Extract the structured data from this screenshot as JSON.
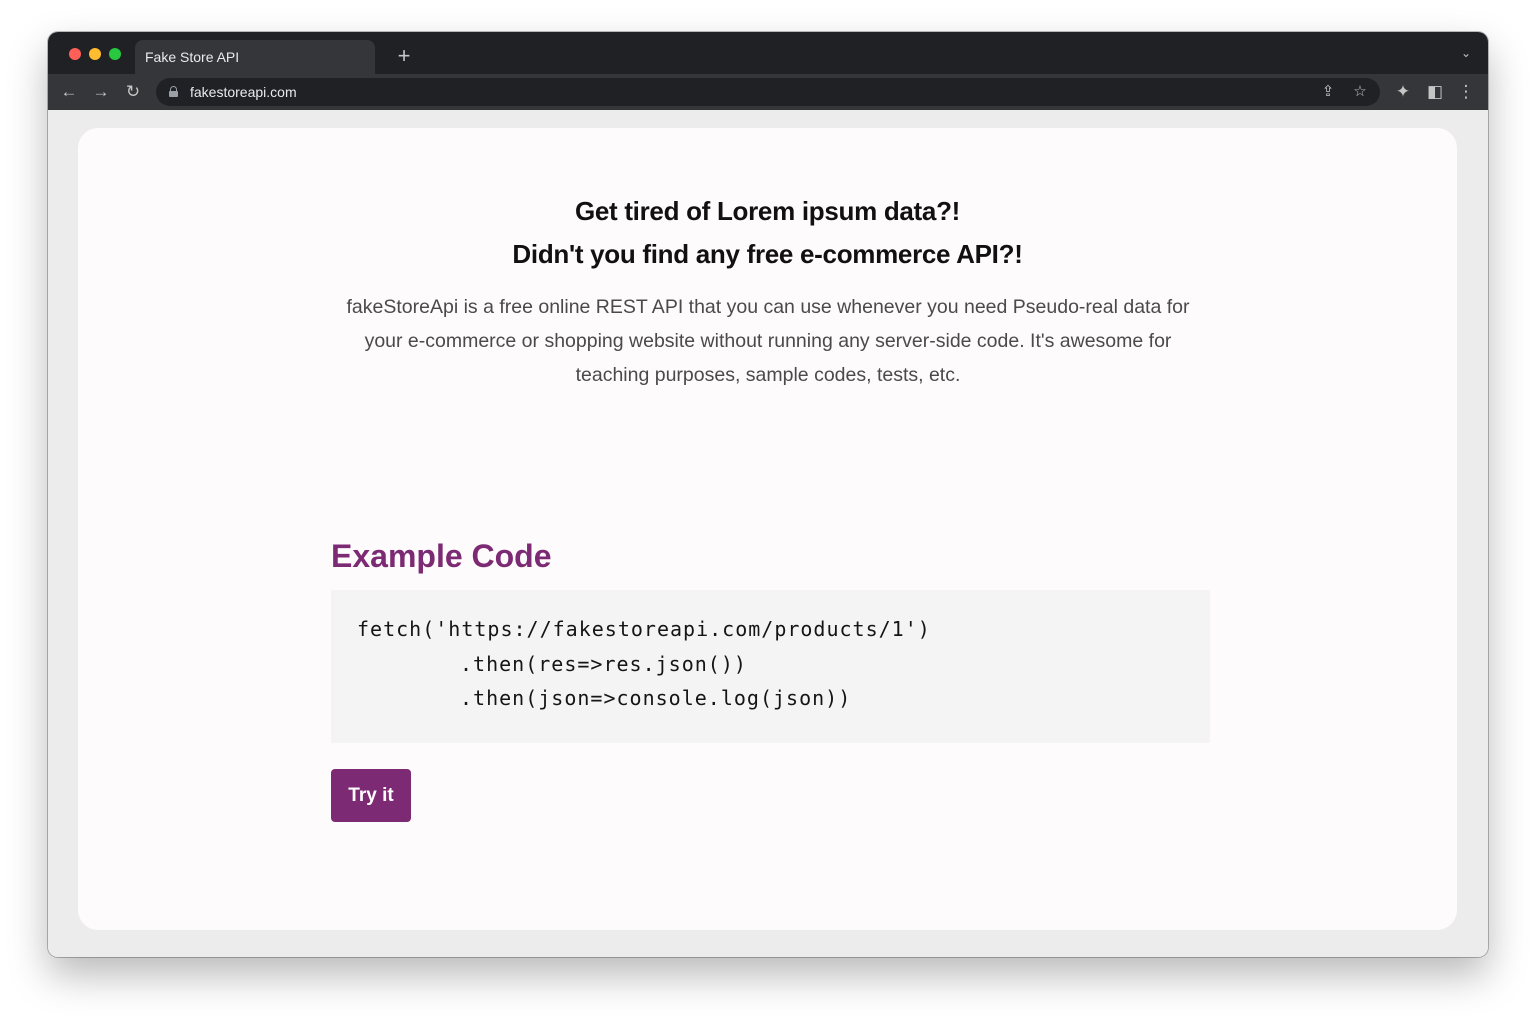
{
  "browser": {
    "tab_title": "Fake Store API",
    "new_tab_glyph": "+",
    "tab_menu_glyph": "⌄",
    "url": "fakestoreapi.com",
    "nav": {
      "back_glyph": "←",
      "forward_glyph": "→",
      "reload_glyph": "↻"
    },
    "icons": {
      "share_glyph": "⇪",
      "bookmark_glyph": "☆",
      "extensions_glyph": "✦",
      "sidepanel_glyph": "◧",
      "menu_glyph": "⋮"
    }
  },
  "hero": {
    "title_line1": "Get tired of Lorem ipsum data?!",
    "title_line2": "Didn't you find any free e-commerce API?!",
    "description": "fakeStoreApi is a free online REST API that you can use whenever you need Pseudo-real data for your e-commerce or shopping website without running any server-side code. It's awesome for teaching purposes, sample codes, tests, etc."
  },
  "example": {
    "title": "Example Code",
    "code_lines": [
      "fetch('https://fakestoreapi.com/products/1')",
      ".then(res=>res.json())",
      ".then(json=>console.log(json))"
    ],
    "button_label": "Try it"
  },
  "colors": {
    "accent": "#7d2a74",
    "browser_dark": "#202124",
    "toolbar": "#35363a"
  }
}
